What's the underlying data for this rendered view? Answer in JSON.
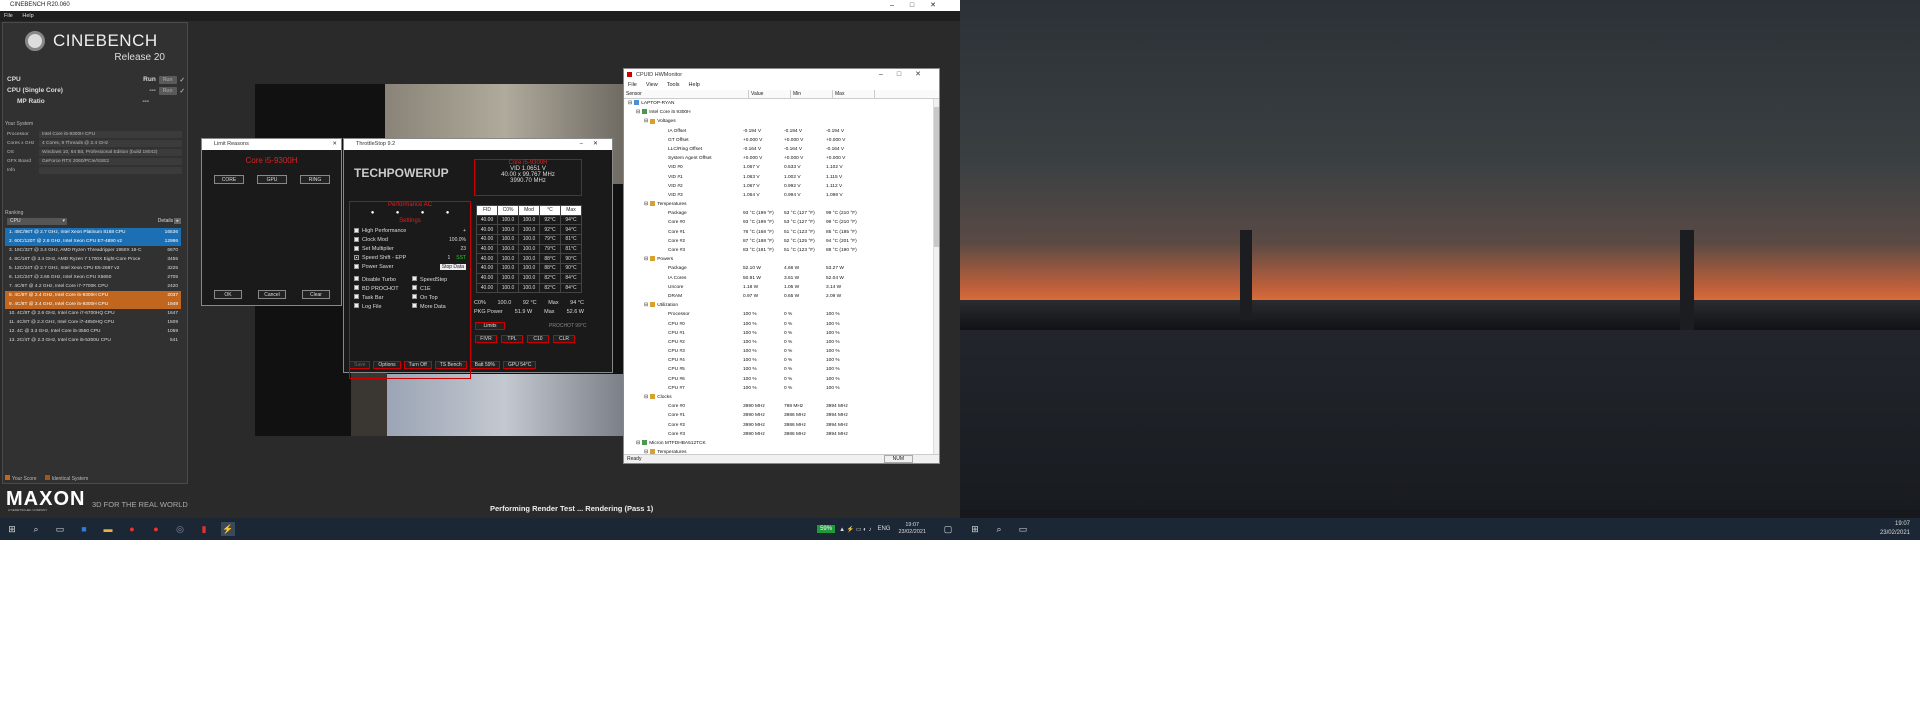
{
  "cinebench": {
    "title": "CINEBENCH R20.060",
    "menu": [
      "File",
      "Help"
    ],
    "logo": "CINEBENCH",
    "release": "Release 20",
    "tests": [
      {
        "label": "CPU",
        "state": "Run",
        "btn": "Run"
      },
      {
        "label": "CPU (Single Core)",
        "state": "---",
        "btn": "Run"
      },
      {
        "label": "MP Ratio",
        "state": "---",
        "btn": ""
      }
    ],
    "system_header": "Your System",
    "system": [
      {
        "k": "Processor",
        "v": "Intel Core i5-9300H CPU"
      },
      {
        "k": "Cores x GHz",
        "v": "4 Cores, 8 Threads @ 2.4 GHz"
      },
      {
        "k": "OS",
        "v": "Windows 10, 64 Bit, Professional Edition (build 19042)"
      },
      {
        "k": "GFX Board",
        "v": "GeForce RTX 2060/PCIe/SSE2"
      },
      {
        "k": "Info",
        "v": ""
      }
    ],
    "ranking_header": "Ranking",
    "ranking_select": "CPU",
    "details": "Details",
    "ranking": [
      {
        "n": "1. 48C/96T @ 2.7 GHz, Intel Xeon Platinum 8168 CPU",
        "s": "16536",
        "hl": 1
      },
      {
        "n": "2. 60C/120T @ 2.8 GHz, Intel Xeon CPU E7-4890 v2",
        "s": "12986",
        "hl": 1
      },
      {
        "n": "3. 16C/32T @ 3.4 GHz, AMD Ryzen Threadripper 1950X 16-C",
        "s": "6670",
        "hl": 0
      },
      {
        "n": "4. 8C/16T @ 3.4 GHz, AMD Ryzen 7 1700X Eight-Core Proce",
        "s": "3455",
        "hl": 0
      },
      {
        "n": "5. 12C/24T @ 2.7 GHz, Intel Xeon CPU E5-2697 v2",
        "s": "3225",
        "hl": 0
      },
      {
        "n": "6. 12C/24T @ 2.66 GHz, Intel Xeon CPU X5650",
        "s": "2705",
        "hl": 0
      },
      {
        "n": "7. 4C/8T @ 4.2 GHz, Intel Core i7-7700K CPU",
        "s": "2420",
        "hl": 0
      },
      {
        "n": "8. 4C/8T @ 2.4 GHz, Intel Core i5-9300H CPU",
        "s": "2037",
        "hl": 2
      },
      {
        "n": "9. 4C/8T @ 2.4 GHz, Intel Core i5-9300H CPU",
        "s": "1949",
        "hl": 2
      },
      {
        "n": "10. 4C/8T @ 2.6 GHz, Intel Core i7-6700HQ CPU",
        "s": "1647",
        "hl": 0
      },
      {
        "n": "11. 4C/8T @ 2.3 GHz, Intel Core i7-4850HQ CPU",
        "s": "1509",
        "hl": 0
      },
      {
        "n": "12. 4C @ 3.3 GHz, Intel Core i5-3550 CPU",
        "s": "1059",
        "hl": 0
      },
      {
        "n": "13. 2C/4T @ 2.3 GHz, Intel Core i5-5300U CPU",
        "s": "541",
        "hl": 0
      }
    ],
    "legend": [
      "Your Score",
      "Identical System"
    ],
    "maxon": "MAXON",
    "maxon_sub": "A NEMETSCHEK COMPANY",
    "tagline": "3D FOR THE REAL WORLD",
    "status": "Performing Render Test ... Rendering (Pass 1)"
  },
  "limit": {
    "title": "Limit Reasons",
    "cpu": "Core i5-9300H",
    "tabs": [
      "CORE",
      "GPU",
      "RING"
    ],
    "ok": "OK",
    "cancel": "Cancel",
    "clear": "Clear"
  },
  "throttlestop": {
    "title": "ThrottleStop 9.2",
    "brand": "TECHPOWERUP",
    "cpu": "Core i5-9300H",
    "vid": "VID  1.0651 V",
    "ratio": "40.00 x 99.767 MHz",
    "freq": "3990.70 MHz",
    "profile": "Performance AC",
    "settings": "Settings",
    "options": [
      {
        "l": "High Performance",
        "on": false,
        "extra": "+"
      },
      {
        "l": "Clock Mod",
        "on": false,
        "extra": "100.0%"
      },
      {
        "l": "Set Multiplier",
        "on": false,
        "extra": "23"
      },
      {
        "l": "Speed Shift - EPP",
        "on": true,
        "extra": "1"
      },
      {
        "l": "Power Saver",
        "on": false,
        "extra": "Stop Data"
      }
    ],
    "sst": "SST",
    "opts2": [
      [
        "Disable Turbo",
        "SpeedStep"
      ],
      [
        "BD PROCHOT",
        "C1E"
      ],
      [
        "Task Bar",
        "On Top"
      ],
      [
        "Log File",
        "More Data"
      ]
    ],
    "table_head": [
      "FID",
      "C0%",
      "Mod",
      "°C",
      "Max"
    ],
    "table": [
      [
        "40.00",
        "100.0",
        "100.0",
        "92°C",
        "94°C"
      ],
      [
        "40.00",
        "100.0",
        "100.0",
        "92°C",
        "94°C"
      ],
      [
        "40.00",
        "100.0",
        "100.0",
        "79°C",
        "81°C"
      ],
      [
        "40.00",
        "100.0",
        "100.0",
        "79°C",
        "81°C"
      ],
      [
        "40.00",
        "100.0",
        "100.0",
        "88°C",
        "90°C"
      ],
      [
        "40.00",
        "100.0",
        "100.0",
        "88°C",
        "90°C"
      ],
      [
        "40.00",
        "100.0",
        "100.0",
        "82°C",
        "84°C"
      ],
      [
        "40.00",
        "100.0",
        "100.0",
        "82°C",
        "84°C"
      ]
    ],
    "c0": "C0%",
    "c0v": "100.0",
    "temp": "92 °C",
    "max": "Max",
    "maxv": "94 °C",
    "pkg": "PKG Power",
    "pkgv": "51.9 W",
    "pkgmaxv": "52.6 W",
    "limits": "Limits",
    "prochot": "PROCHOT 99°C",
    "bottom_btns": [
      "FIVR",
      "TPL",
      "C10",
      "CLR"
    ],
    "footer_btns": [
      "Save",
      "Options",
      "Turn Off",
      "TS Bench",
      "Batt 59%",
      "GPU 54°C"
    ]
  },
  "hwmon": {
    "title": "CPUID HWMonitor",
    "menu": [
      "File",
      "View",
      "Tools",
      "Help"
    ],
    "cols": [
      "Sensor",
      "Value",
      "Min",
      "Max"
    ],
    "rows": [
      [
        "LAPTOP-RYAN",
        "",
        "",
        "",
        0
      ],
      [
        "Intel Core i5 9300H",
        "",
        "",
        "",
        1
      ],
      [
        "Voltages",
        "",
        "",
        "",
        2
      ],
      [
        "IA Offset",
        "-0.194 V",
        "-0.194 V",
        "-0.194 V",
        3
      ],
      [
        "GT Offset",
        "+0.000 V",
        "+0.000 V",
        "+0.000 V",
        3
      ],
      [
        "LLC/Ring Offset",
        "-0.164 V",
        "-0.164 V",
        "-0.164 V",
        3
      ],
      [
        "System Agent Offset",
        "+0.000 V",
        "+0.000 V",
        "+0.000 V",
        3
      ],
      [
        "VID #0",
        "1.067 V",
        "0.533 V",
        "1.102 V",
        3
      ],
      [
        "VID #1",
        "1.063 V",
        "1.002 V",
        "1.115 V",
        3
      ],
      [
        "VID #2",
        "1.067 V",
        "0.992 V",
        "1.112 V",
        3
      ],
      [
        "VID #3",
        "1.064 V",
        "0.994 V",
        "1.098 V",
        3
      ],
      [
        "Temperatures",
        "",
        "",
        "",
        2
      ],
      [
        "Package",
        "93 °C (199 °F)",
        "53 °C (127 °F)",
        "99 °C (210 °F)",
        3
      ],
      [
        "Core #0",
        "93 °C (199 °F)",
        "53 °C (127 °F)",
        "99 °C (210 °F)",
        3
      ],
      [
        "Core #1",
        "76 °C (168 °F)",
        "51 °C (123 °F)",
        "85 °C (185 °F)",
        3
      ],
      [
        "Core #2",
        "87 °C (188 °F)",
        "52 °C (125 °F)",
        "94 °C (201 °F)",
        3
      ],
      [
        "Core #3",
        "83 °C (181 °F)",
        "51 °C (123 °F)",
        "88 °C (190 °F)",
        3
      ],
      [
        "Powers",
        "",
        "",
        "",
        2
      ],
      [
        "Package",
        "52.10 W",
        "4.66 W",
        "53.27 W",
        3
      ],
      [
        "IA Cores",
        "50.91 W",
        "3.61 W",
        "52.04 W",
        3
      ],
      [
        "Uncore",
        "1.18 W",
        "1.05 W",
        "3.14 W",
        3
      ],
      [
        "DRAM",
        "0.97 W",
        "0.65 W",
        "2.09 W",
        3
      ],
      [
        "Utilization",
        "",
        "",
        "",
        2
      ],
      [
        "Processor",
        "100 %",
        "0 %",
        "100 %",
        3
      ],
      [
        "CPU #0",
        "100 %",
        "0 %",
        "100 %",
        3
      ],
      [
        "CPU #1",
        "100 %",
        "0 %",
        "100 %",
        3
      ],
      [
        "CPU #2",
        "100 %",
        "0 %",
        "100 %",
        3
      ],
      [
        "CPU #3",
        "100 %",
        "0 %",
        "100 %",
        3
      ],
      [
        "CPU #4",
        "100 %",
        "0 %",
        "100 %",
        3
      ],
      [
        "CPU #5",
        "100 %",
        "0 %",
        "100 %",
        3
      ],
      [
        "CPU #6",
        "100 %",
        "0 %",
        "100 %",
        3
      ],
      [
        "CPU #7",
        "100 %",
        "0 %",
        "100 %",
        3
      ],
      [
        "Clocks",
        "",
        "",
        "",
        2
      ],
      [
        "Core #0",
        "3990 MHz",
        "798 MHz",
        "3994 MHz",
        3
      ],
      [
        "Core #1",
        "3990 MHz",
        "3986 MHz",
        "3994 MHz",
        3
      ],
      [
        "Core #2",
        "3990 MHz",
        "3986 MHz",
        "3994 MHz",
        3
      ],
      [
        "Core #3",
        "3990 MHz",
        "3986 MHz",
        "3994 MHz",
        3
      ],
      [
        "Micron MTFDHBA512TCK",
        "",
        "",
        "",
        1
      ],
      [
        "Temperatures",
        "",
        "",
        "",
        2
      ]
    ],
    "status": "Ready",
    "num": "NUM"
  },
  "taskbar": {
    "battery": "59%",
    "lang": "ENG",
    "time": "19:07",
    "date": "23/02/2021",
    "time2": "19:07",
    "date2": "23/02/2021"
  }
}
